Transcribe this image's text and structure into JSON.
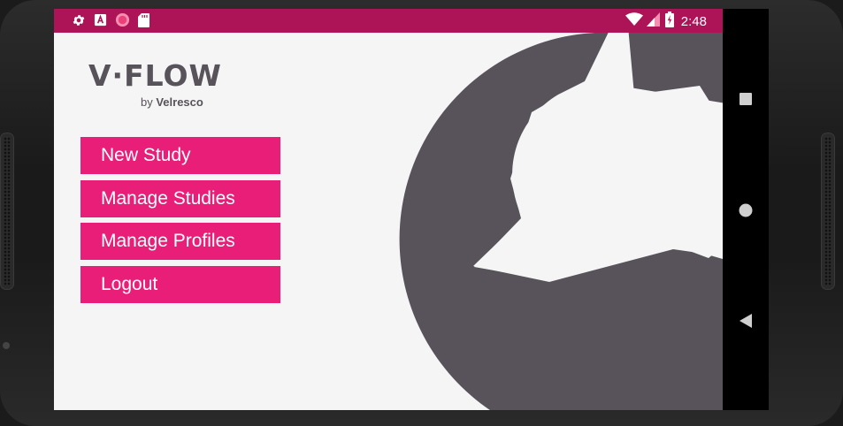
{
  "status_bar": {
    "time": "2:48",
    "left_icons": [
      "settings-icon",
      "a-icon",
      "circle-icon",
      "sd-card-icon"
    ],
    "right_icons": [
      "wifi-icon",
      "signal-icon",
      "battery-icon"
    ]
  },
  "logo": {
    "main": "V·FLOW",
    "by": "by ",
    "brand": "Velresco"
  },
  "menu": {
    "items": [
      {
        "label": "New Study"
      },
      {
        "label": "Manage Studies"
      },
      {
        "label": "Manage Profiles"
      },
      {
        "label": "Logout"
      }
    ]
  },
  "nav_bar": {
    "buttons": [
      "recents-icon",
      "home-icon",
      "back-icon"
    ]
  },
  "colors": {
    "status_bar": "#ad1457",
    "button": "#e91e78",
    "logo": "#58535a",
    "shape": "#58535a",
    "background": "#f5f5f5"
  }
}
